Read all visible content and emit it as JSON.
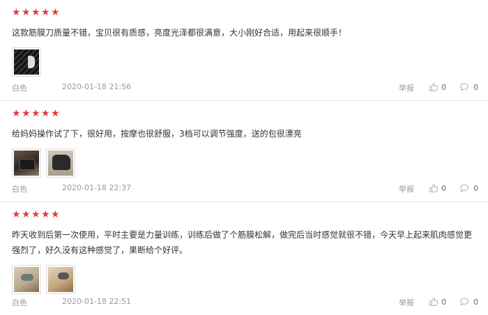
{
  "reviews": [
    {
      "rating": 5,
      "text": "这款筋膜刀质量不错，宝贝很有质感，亮度光泽都很满意，大小刚好合适，用起来很顺手！",
      "photos": [
        "black-product-photo"
      ],
      "color": "白色",
      "date": "2020-01-18 21:56",
      "report": "举报",
      "likes": "0",
      "comments": "0"
    },
    {
      "rating": 5,
      "text": "给妈妈操作试了下，很好用，按摩也很舒服，3档可以调节强度，送的包很漂亮",
      "photos": [
        "product-box-photo",
        "product-pouch-photo"
      ],
      "color": "白色",
      "date": "2020-01-18 22:37",
      "report": "举报",
      "likes": "0",
      "comments": "0"
    },
    {
      "rating": 5,
      "text": "昨天收到后第一次使用，平时主要是力量训练，训练后做了个筋膜松解，做完后当时感觉就很不错，今天早上起来肌肉感觉更强烈了，好久没有这种感觉了，果断给个好评。",
      "photos": [
        "usage-photo-1",
        "usage-photo-2"
      ],
      "color": "白色",
      "date": "2020-01-18 22:51",
      "report": "举报",
      "likes": "0",
      "comments": "0"
    }
  ],
  "colors": {
    "star": "#e4393c",
    "meta": "#999999",
    "divider": "#e8e8e8"
  },
  "icons": {
    "star": "star-icon",
    "like": "thumbs-up-icon",
    "comment": "comment-bubble-icon"
  }
}
